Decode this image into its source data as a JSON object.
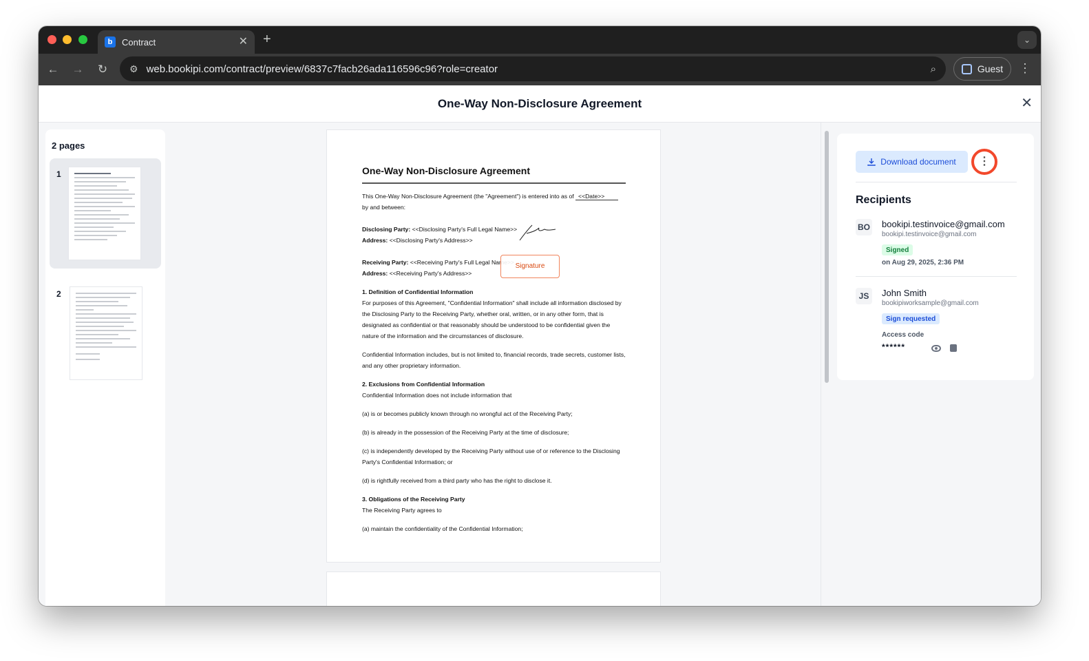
{
  "browser": {
    "tab_title": "Contract",
    "favicon_letter": "b",
    "url": "web.bookipi.com/contract/preview/6837c7facb26ada116596c96?role=creator",
    "profile_label": "Guest"
  },
  "modal": {
    "title": "One-Way Non-Disclosure Agreement"
  },
  "thumbnails": {
    "pages_label": "2 pages",
    "pages": [
      {
        "number": "1"
      },
      {
        "number": "2"
      }
    ]
  },
  "document": {
    "title": "One-Way Non-Disclosure Agreement",
    "intro_before": "This One-Way Non-Disclosure Agreement (the \"Agreement\") is entered into as of",
    "date_placeholder": "<<Date>>",
    "intro_after": "by and between:",
    "disclosing_label": "Disclosing Party:",
    "disclosing_name": "<<Disclosing Party's Full Legal Name>>",
    "address_label_1": "Address:",
    "disclosing_address": "<<Disclosing Party's Address>>",
    "receiving_label": "Receiving Party:",
    "receiving_name": "<<Receiving Party's Full Legal Name>>",
    "address_label_2": "Address:",
    "receiving_address": "<<Receiving Party's Address>>",
    "signature_field": "Signature",
    "section1_heading": "1. Definition of Confidential Information",
    "section1_p1": "For purposes of this Agreement, \"Confidential Information\" shall include all information disclosed by the Disclosing Party to the Receiving Party, whether oral, written, or in any other form, that is designated as confidential or that reasonably should be understood to be confidential given the nature of the information and the circumstances of disclosure.",
    "section1_p2": "Confidential Information includes, but is not limited to, financial records, trade secrets, customer lists, and any other proprietary information.",
    "section2_heading": "2. Exclusions from Confidential Information",
    "section2_intro": "Confidential Information does not include information that",
    "section2_a": "(a) is or becomes publicly known through no wrongful act of the Receiving Party;",
    "section2_b": "(b) is already in the possession of the Receiving Party at the time of disclosure;",
    "section2_c": "(c) is independently developed by the Receiving Party without use of or reference to the Disclosing Party's Confidential Information; or",
    "section2_d": "(d) is rightfully received from a third party who has the right to disclose it.",
    "section3_heading": "3. Obligations of the Receiving Party",
    "section3_intro": "The Receiving Party agrees to",
    "section3_a": "(a) maintain the confidentiality of the Confidential Information;"
  },
  "panel": {
    "download_label": "Download document",
    "recipients_title": "Recipients",
    "recipients": [
      {
        "initials": "BO",
        "name": "bookipi.testinvoice@gmail.com",
        "email": "bookipi.testinvoice@gmail.com",
        "status": "Signed",
        "signed_at": "on Aug 29, 2025, 2:36 PM"
      },
      {
        "initials": "JS",
        "name": "John Smith",
        "email": "bookipiworksample@gmail.com",
        "status": "Sign requested",
        "access_code_label": "Access code",
        "access_code_value": "******"
      }
    ]
  },
  "colors": {
    "accent_blue": "#1d4ed8",
    "highlight_ring": "#f2482b",
    "signature_border": "#f0845c",
    "signed_green": "#15803d"
  }
}
